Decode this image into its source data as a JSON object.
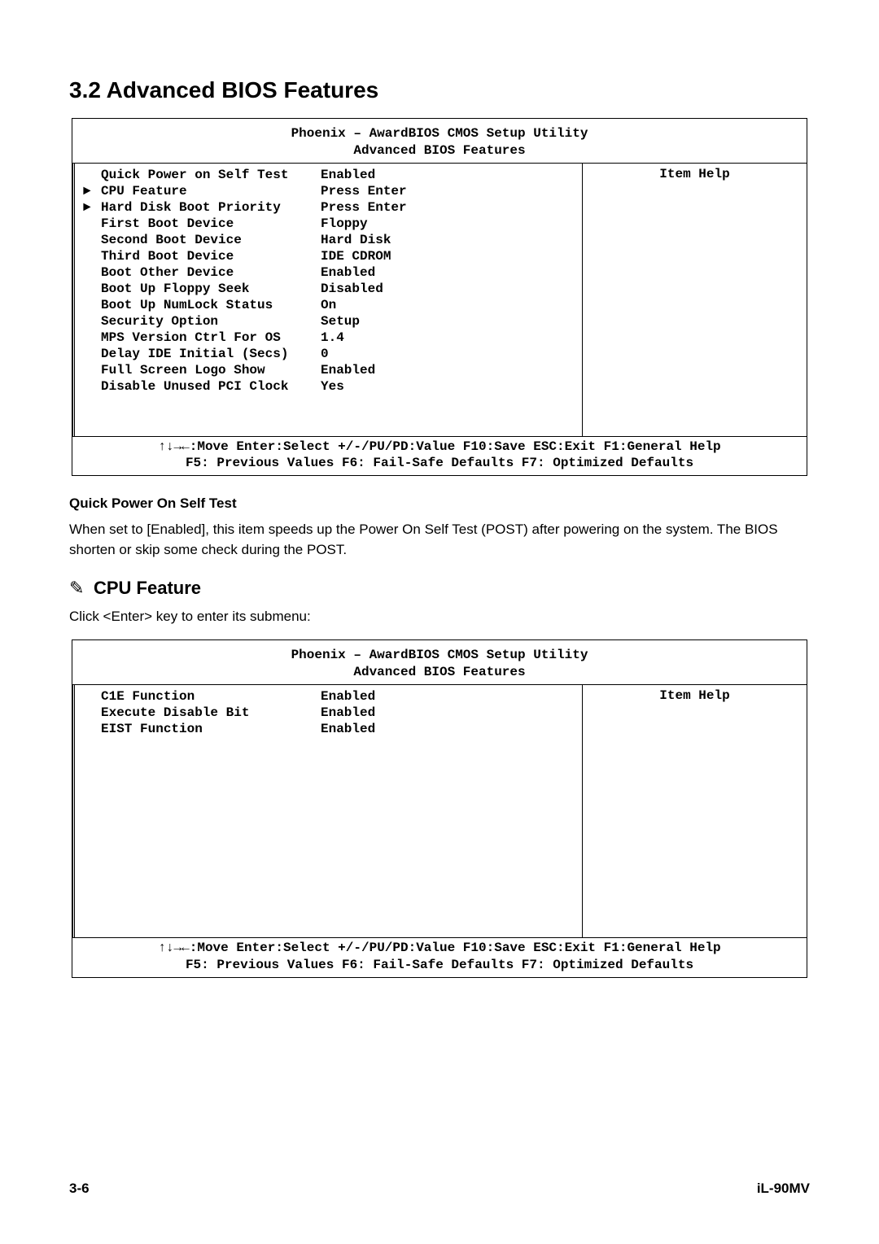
{
  "heading": "3.2 Advanced BIOS Features",
  "bios_header_line1": "Phoenix – AwardBIOS CMOS Setup Utility",
  "bios_header_line2": "Advanced BIOS Features",
  "help_title": "Item Help",
  "panel1": {
    "rows": [
      {
        "arrow": "",
        "label": "Quick Power on Self Test",
        "value": "Enabled"
      },
      {
        "arrow": "►",
        "label": "CPU Feature",
        "value": "Press Enter"
      },
      {
        "arrow": "►",
        "label": "Hard Disk Boot Priority",
        "value": "Press Enter"
      },
      {
        "arrow": "",
        "label": "First Boot Device",
        "value": "Floppy"
      },
      {
        "arrow": "",
        "label": "Second Boot Device",
        "value": "Hard Disk"
      },
      {
        "arrow": "",
        "label": "Third Boot Device",
        "value": "IDE CDROM"
      },
      {
        "arrow": "",
        "label": "Boot Other Device",
        "value": "Enabled"
      },
      {
        "arrow": "",
        "label": "Boot Up Floppy Seek",
        "value": "Disabled"
      },
      {
        "arrow": "",
        "label": "Boot Up NumLock Status",
        "value": "On"
      },
      {
        "arrow": "",
        "label": "Security Option",
        "value": "Setup"
      },
      {
        "arrow": "",
        "label": "MPS Version Ctrl For OS",
        "value": "1.4"
      },
      {
        "arrow": "",
        "label": "Delay IDE Initial (Secs)",
        "value": " 0"
      },
      {
        "arrow": "",
        "label": "Full Screen Logo Show",
        "value": "Enabled"
      },
      {
        "arrow": "",
        "label": "Disable Unused PCI Clock",
        "value": "Yes"
      }
    ]
  },
  "footer_line1": "↑↓→←:Move  Enter:Select  +/-/PU/PD:Value  F10:Save  ESC:Exit  F1:General Help",
  "footer_line2": "F5: Previous Values   F6: Fail-Safe Defaults   F7: Optimized Defaults",
  "subheading": "Quick Power On Self Test",
  "description": "When set to [Enabled], this item speeds up the Power On Self Test (POST) after powering on the system. The BIOS shorten or skip some check during the POST.",
  "cpu_heading": "CPU Feature",
  "cpu_intro": "Click <Enter> key to enter its submenu:",
  "panel2": {
    "rows": [
      {
        "arrow": "",
        "label": "C1E Function",
        "value": "Enabled"
      },
      {
        "arrow": "",
        "label": "Execute Disable Bit",
        "value": "Enabled"
      },
      {
        "arrow": "",
        "label": "EIST Function",
        "value": "Enabled"
      }
    ]
  },
  "page_number": "3-6",
  "doc_id": "iL-90MV"
}
